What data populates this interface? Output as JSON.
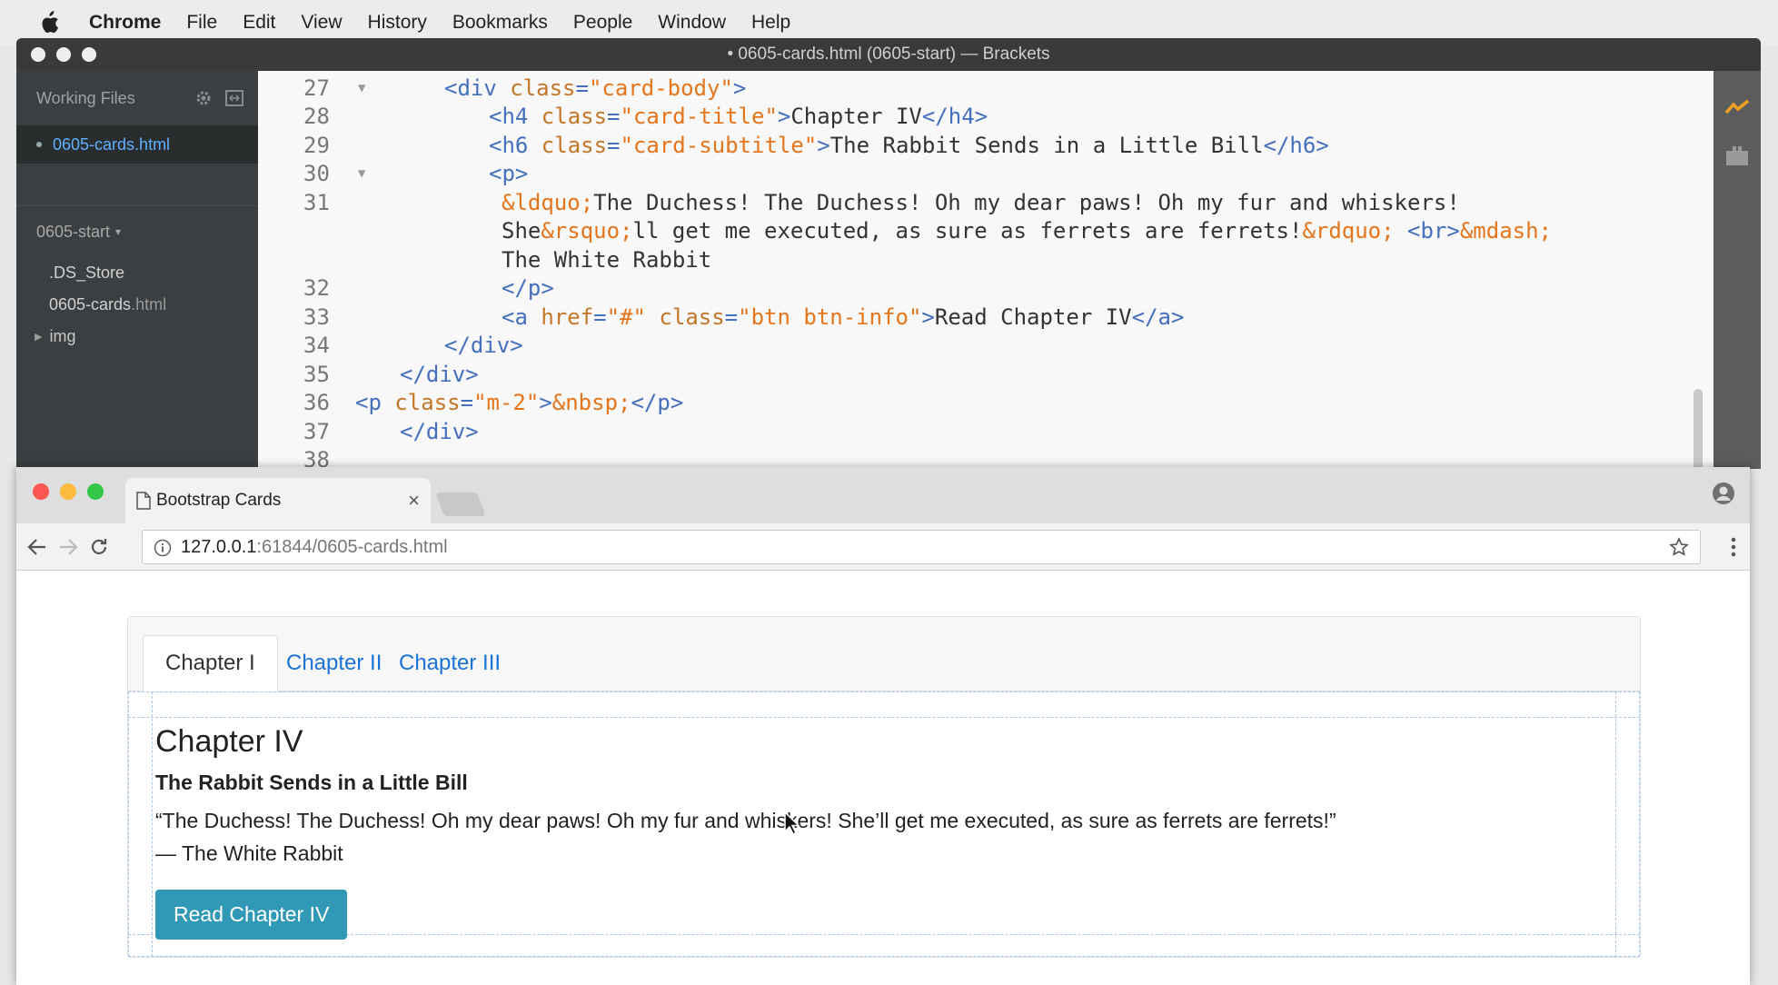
{
  "menubar": {
    "app": "Chrome",
    "items": [
      "File",
      "Edit",
      "View",
      "History",
      "Bookmarks",
      "People",
      "Window",
      "Help"
    ]
  },
  "brackets": {
    "window_title": "• 0605-cards.html (0605-start) — Brackets",
    "sidebar": {
      "working_files_label": "Working Files",
      "working_file": "0605-cards.html",
      "project": "0605-start",
      "files": [
        {
          "name": ".DS_Store",
          "ext": ""
        },
        {
          "name": "0605-cards",
          "ext": ".html"
        }
      ],
      "folder": "img"
    },
    "lines": [
      {
        "n": "27",
        "fold": true,
        "parts": [
          [
            "tg",
            "<div "
          ],
          [
            "at",
            "class"
          ],
          [
            "tg",
            "="
          ],
          [
            "st",
            "\"card-body\""
          ],
          [
            "tg",
            ">"
          ]
        ],
        "indent": 2
      },
      {
        "n": "28",
        "fold": false,
        "parts": [
          [
            "tg",
            "<h4 "
          ],
          [
            "at",
            "class"
          ],
          [
            "tg",
            "="
          ],
          [
            "st",
            "\"card-title\""
          ],
          [
            "tg",
            ">"
          ],
          [
            "tx",
            "Chapter IV"
          ],
          [
            "tg",
            "</h4>"
          ]
        ],
        "indent": 3
      },
      {
        "n": "29",
        "fold": false,
        "parts": [
          [
            "tg",
            "<h6 "
          ],
          [
            "at",
            "class"
          ],
          [
            "tg",
            "="
          ],
          [
            "st",
            "\"card-subtitle\""
          ],
          [
            "tg",
            ">"
          ],
          [
            "tx",
            "The Rabbit Sends in a Little Bill"
          ],
          [
            "tg",
            "</h6>"
          ]
        ],
        "indent": 3
      },
      {
        "n": "30",
        "fold": true,
        "parts": [
          [
            "tg",
            "<p>"
          ]
        ],
        "indent": 3
      },
      {
        "n": "31",
        "fold": false,
        "parts": [
          [
            "en",
            "&ldquo;"
          ],
          [
            "tx",
            "The Duchess! The Duchess! Oh my dear paws! Oh my fur and whiskers!"
          ]
        ],
        "indent": 4
      },
      {
        "n": "",
        "fold": false,
        "parts": [
          [
            "tx",
            "She"
          ],
          [
            "en",
            "&rsquo;"
          ],
          [
            "tx",
            "ll get me executed, as sure as ferrets are ferrets!"
          ],
          [
            "en",
            "&rdquo;"
          ],
          [
            "tx",
            " "
          ],
          [
            "tg",
            "<br>"
          ],
          [
            "en",
            "&mdash;"
          ]
        ],
        "indent": 4
      },
      {
        "n": "",
        "fold": false,
        "parts": [
          [
            "tx",
            "The White Rabbit"
          ]
        ],
        "indent": 4
      },
      {
        "n": "32",
        "fold": false,
        "parts": [
          [
            "tg",
            "</p>"
          ]
        ],
        "indent": 4
      },
      {
        "n": "33",
        "fold": false,
        "parts": [
          [
            "tg",
            "<a "
          ],
          [
            "at",
            "href"
          ],
          [
            "tg",
            "="
          ],
          [
            "st",
            "\"#\""
          ],
          [
            "tx",
            " "
          ],
          [
            "at",
            "class"
          ],
          [
            "tg",
            "="
          ],
          [
            "st",
            "\"btn btn-info\""
          ],
          [
            "tg",
            ">"
          ],
          [
            "tx",
            "Read Chapter IV"
          ],
          [
            "tg",
            "</a>"
          ]
        ],
        "indent": 4
      },
      {
        "n": "34",
        "fold": false,
        "parts": [
          [
            "tg",
            "</div>"
          ]
        ],
        "indent": 2
      },
      {
        "n": "35",
        "fold": false,
        "parts": [
          [
            "tg",
            "</div>"
          ]
        ],
        "indent": 1
      },
      {
        "n": "36",
        "fold": false,
        "parts": [
          [
            "tg",
            "<p "
          ],
          [
            "at",
            "class"
          ],
          [
            "tg",
            "="
          ],
          [
            "st",
            "\"m-2\""
          ],
          [
            "tg",
            ">"
          ],
          [
            "en",
            "&nbsp;"
          ],
          [
            "tg",
            "</p>"
          ]
        ],
        "indent": 0
      },
      {
        "n": "37",
        "fold": false,
        "parts": [
          [
            "tg",
            "</div>"
          ]
        ],
        "indent": 1
      },
      {
        "n": "38",
        "fold": false,
        "parts": [],
        "indent": 0
      }
    ]
  },
  "chrome": {
    "tab_title": "Bootstrap Cards",
    "close_glyph": "×",
    "url_host": "127.0.0.1",
    "url_rest": ":61844/0605-cards.html"
  },
  "card": {
    "tabs": [
      "Chapter I",
      "Chapter II",
      "Chapter III"
    ],
    "title": "Chapter IV",
    "subtitle": "The Rabbit Sends in a Little Bill",
    "quote": "“The Duchess! The Duchess! Oh my dear paws! Oh my fur and whiskers! She’ll get me executed, as sure as ferrets are ferrets!”",
    "attribution": "— The White Rabbit",
    "button": "Read Chapter IV"
  },
  "colors": {
    "link": "#1a73d6",
    "btn_info": "#3199b5",
    "code_tag": "#446fbd",
    "code_attr": "#c37628",
    "code_string": "#e4751b"
  }
}
